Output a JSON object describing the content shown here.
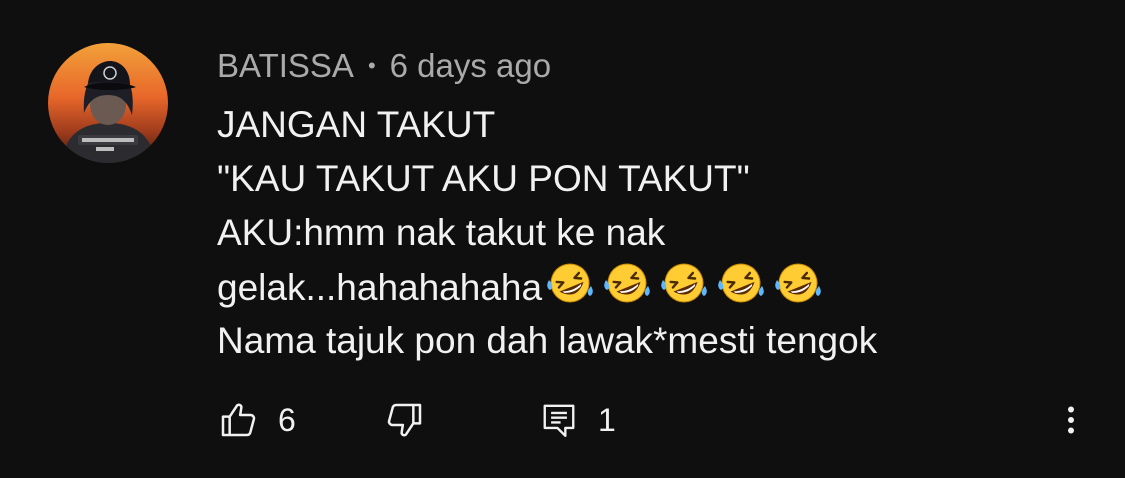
{
  "comment": {
    "author": "BATISSA",
    "separator": "•",
    "time": "6 days ago",
    "lines": [
      "JANGAN TAKUT",
      "\"KAU TAKUT AKU PON TAKUT\"",
      "AKU:hmm nak takut ke nak",
      "gelak...hahahahaha",
      "Nama tajuk pon dah lawak*mesti tengok"
    ],
    "emoji": "rolling-on-floor-laughing",
    "emoji_count": 5
  },
  "actions": {
    "like_icon": "thumbs-up-icon",
    "like_count": "6",
    "dislike_icon": "thumbs-down-icon",
    "reply_icon": "comment-icon",
    "reply_count": "1",
    "more_icon": "more-vertical-icon"
  },
  "colors": {
    "background": "#0f0f0f",
    "text": "#f1f1f1",
    "secondary_text": "#aaaaaa",
    "emoji_face": "#ffcc33"
  }
}
